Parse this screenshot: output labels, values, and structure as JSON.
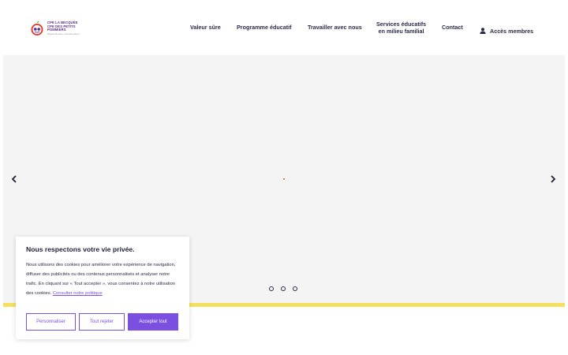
{
  "logo": {
    "line1": "CPE LA BECQUÉE",
    "line2": "CPE DES PETITS POMMIERS",
    "line3": "Rigolet Bureau Coordonnateur"
  },
  "nav": {
    "items": [
      {
        "label": "Valeur sûre"
      },
      {
        "label": "Programme éducatif"
      },
      {
        "label": "Travailler avec nous"
      },
      {
        "label_line1": "Services éducatifs",
        "label_line2": "en milieu familial"
      },
      {
        "label": "Contact"
      }
    ],
    "members_label": "Accès membres"
  },
  "hero": {
    "slide_count": 3
  },
  "cookie_banner": {
    "title": "Nous respectons votre vie privée.",
    "body": "Nous utilisons des cookies pour améliorer votre expérience de navigation, diffuser des publicités ou des contenus personnalisés et analyser notre trafic. En cliquant sur « Tout accepter », vous consentez à notre utilisation des cookies.",
    "link_text": "Consulter notre politique",
    "buttons": {
      "customize": "Personnaliser",
      "reject": "Tout rejeter",
      "accept": "Accepter tout"
    }
  },
  "colors": {
    "accent": "#7b4fe0",
    "nav_text": "#2b2a4a",
    "hero_bg": "#f4f4f4",
    "band": "#f5e15f"
  }
}
